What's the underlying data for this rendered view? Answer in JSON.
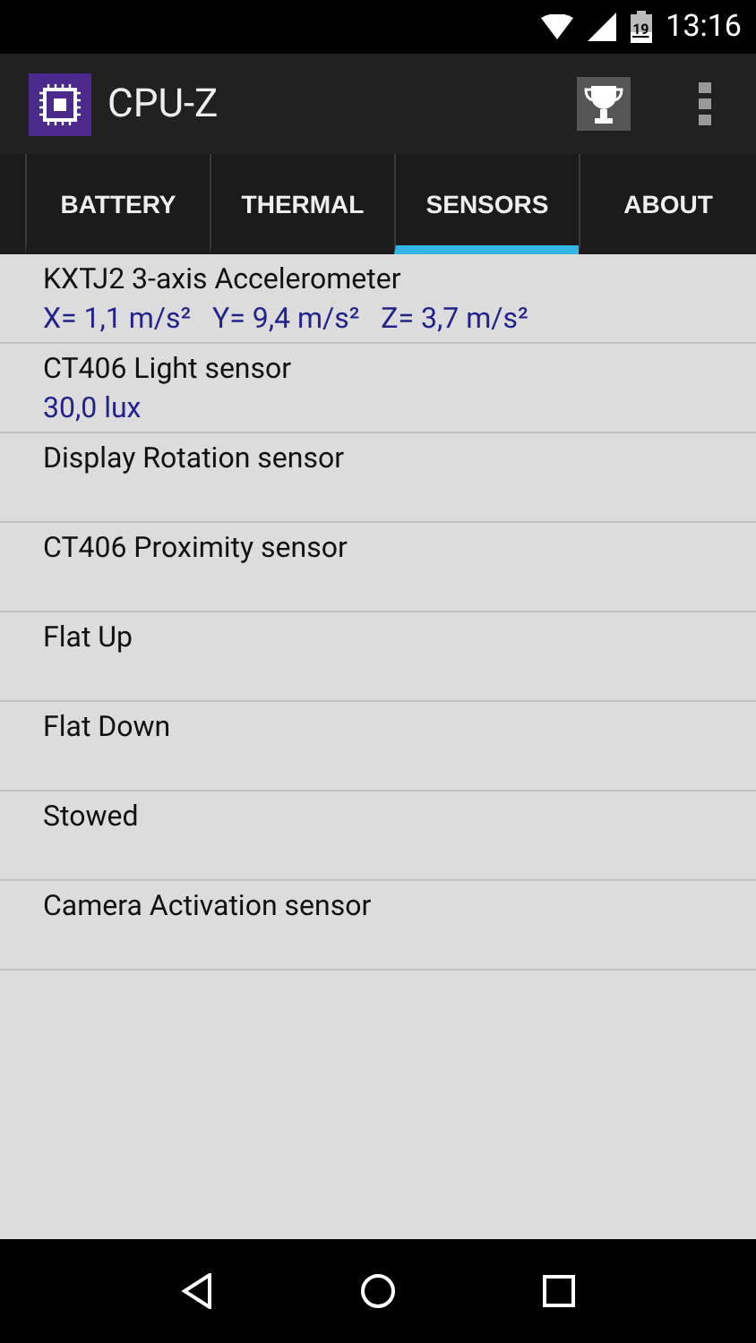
{
  "status_bar": {
    "battery": "19",
    "time": "13:16"
  },
  "app_bar": {
    "title": "CPU-Z"
  },
  "tabs": [
    {
      "label": "BATTERY",
      "selected": false
    },
    {
      "label": "THERMAL",
      "selected": false
    },
    {
      "label": "SENSORS",
      "selected": true
    },
    {
      "label": "ABOUT",
      "selected": false
    }
  ],
  "sensors": [
    {
      "name": "KXTJ2 3-axis Accelerometer",
      "value": "X= 1,1 m/s²   Y= 9,4 m/s²   Z= 3,7 m/s²"
    },
    {
      "name": "CT406 Light sensor",
      "value": "30,0 lux"
    },
    {
      "name": "Display Rotation sensor"
    },
    {
      "name": "CT406 Proximity sensor"
    },
    {
      "name": "Flat Up"
    },
    {
      "name": "Flat Down"
    },
    {
      "name": "Stowed"
    },
    {
      "name": "Camera Activation sensor"
    }
  ]
}
